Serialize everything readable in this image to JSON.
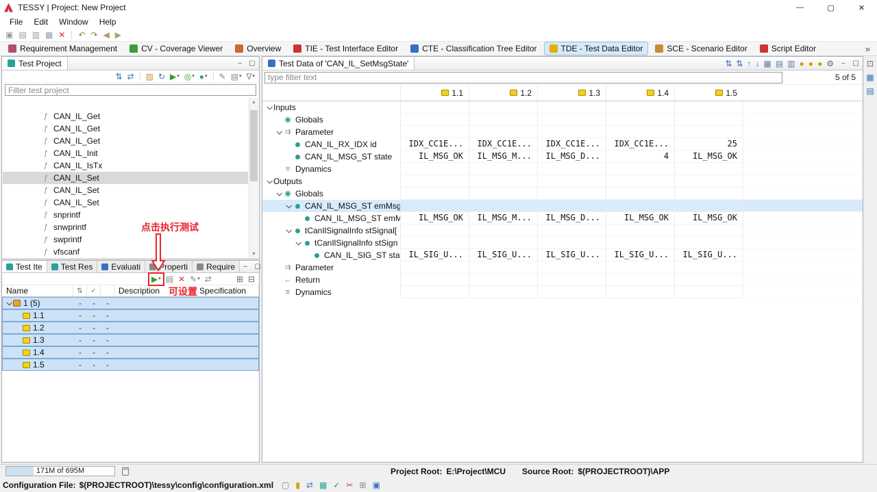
{
  "window": {
    "title": "TESSY | Project: New Project",
    "controls": [
      {
        "name": "minimize-button",
        "glyph": "—"
      },
      {
        "name": "maximize-button",
        "glyph": "▢"
      },
      {
        "name": "close-button",
        "glyph": "✕"
      }
    ]
  },
  "menu": [
    "File",
    "Edit",
    "Window",
    "Help"
  ],
  "main_toolbar": [
    {
      "name": "save-icon",
      "glyph": "▣",
      "color": "#9a9a9a"
    },
    {
      "name": "save-all-icon",
      "glyph": "▤",
      "color": "#9a9a9a"
    },
    {
      "name": "copy-icon",
      "glyph": "▥",
      "color": "#9a9a9a"
    },
    {
      "name": "paste-icon",
      "glyph": "▦",
      "color": "#9a9a9a"
    },
    {
      "name": "delete-icon",
      "glyph": "✕",
      "color": "#cc3333"
    },
    {
      "name": "separator"
    },
    {
      "name": "undo-icon",
      "glyph": "↶",
      "color": "#8a8a4a"
    },
    {
      "name": "redo-icon",
      "glyph": "↷",
      "color": "#8a8a4a"
    },
    {
      "name": "back-icon",
      "glyph": "◀",
      "color": "#b0a060"
    },
    {
      "name": "forward-icon",
      "glyph": "▶",
      "color": "#b0a060"
    }
  ],
  "perspectives": {
    "items": [
      {
        "label": "Requirement Management",
        "icon": "requirement-management-icon",
        "color": "#b05070",
        "active": false
      },
      {
        "label": "CV - Coverage Viewer",
        "icon": "coverage-viewer-icon",
        "color": "#3a9c3a",
        "active": false
      },
      {
        "label": "Overview",
        "icon": "overview-icon",
        "color": "#cc6633",
        "active": false
      },
      {
        "label": "TIE - Test Interface Editor",
        "icon": "tie-icon",
        "color": "#cc3333",
        "active": false
      },
      {
        "label": "CTE - Classification Tree Editor",
        "icon": "cte-icon",
        "color": "#3a6fc4",
        "active": false
      },
      {
        "label": "TDE - Test Data Editor",
        "icon": "tde-icon",
        "color": "#e0b000",
        "active": true
      },
      {
        "label": "SCE - Scenario Editor",
        "icon": "sce-icon",
        "color": "#cc8833",
        "active": false
      },
      {
        "label": "Script Editor",
        "icon": "script-editor-icon",
        "color": "#cc3333",
        "active": false
      }
    ],
    "overflow": "»"
  },
  "icon_map": {
    "function-icon": {
      "glyph": "ƒ",
      "color": "#8a8a8a"
    },
    "globals-icon": {
      "glyph": "◉",
      "color": "#2f9e8f"
    },
    "parameter-icon": {
      "glyph": "⇉",
      "color": "#8a8a8a"
    },
    "dynamics-icon": {
      "glyph": "≡",
      "color": "#5a8aa8"
    },
    "return-icon": {
      "glyph": "←",
      "color": "#2f9e8f"
    },
    "variable-icon": {
      "cls": "dot",
      "color": "#2f9e8f"
    },
    "struct-icon": {
      "cls": "dot",
      "color": "#2f9e8f"
    }
  },
  "test_project": {
    "tab_title": "Test Project",
    "filter_placeholder": "Filter test project",
    "toolbar": [
      {
        "name": "collapse-all-icon",
        "glyph": "⇅",
        "color": "#3a6fc4"
      },
      {
        "name": "link-with-editor-icon",
        "glyph": "⇄",
        "color": "#3a6fc4"
      },
      {
        "name": "separator"
      },
      {
        "name": "new-module-icon",
        "glyph": "▨",
        "color": "#c89b3c"
      },
      {
        "name": "refresh-icon",
        "glyph": "↻",
        "color": "#3a6fc4"
      },
      {
        "name": "run-icon",
        "glyph": "▶",
        "color": "#2e9e2e",
        "dropdown": true
      },
      {
        "name": "coverage-icon",
        "glyph": "◎",
        "color": "#2e9e2e",
        "dropdown": true
      },
      {
        "name": "report-icon",
        "glyph": "●",
        "color": "#2aa198",
        "dropdown": true
      },
      {
        "name": "separator"
      },
      {
        "name": "edit-icon",
        "glyph": "✎",
        "color": "#888888"
      },
      {
        "name": "layout-icon",
        "glyph": "▤",
        "color": "#888888",
        "dropdown": true
      },
      {
        "name": "filter-icon",
        "glyph": "∇",
        "color": "#888888",
        "dropdown": true
      }
    ],
    "items": [
      {
        "label": "CAN_IL_Get"
      },
      {
        "label": "CAN_IL_Get"
      },
      {
        "label": "CAN_IL_Get"
      },
      {
        "label": "CAN_IL_Init"
      },
      {
        "label": "CAN_IL_IsTx"
      },
      {
        "label": "CAN_IL_Set",
        "selected": true
      },
      {
        "label": "CAN_IL_Set"
      },
      {
        "label": "CAN_IL_Set"
      },
      {
        "label": "snprintf"
      },
      {
        "label": "snwprintf"
      },
      {
        "label": "swprintf"
      },
      {
        "label": "vfscanf"
      }
    ]
  },
  "test_items": {
    "tabs": [
      {
        "label": "Test Ite",
        "icon": "test-items-tab-icon",
        "color": "#2aa198",
        "active": true
      },
      {
        "label": "Test Res",
        "icon": "test-results-tab-icon",
        "color": "#2aa198",
        "active": false
      },
      {
        "label": "Evaluati",
        "icon": "evaluation-tab-icon",
        "color": "#3a6fc4",
        "active": false
      },
      {
        "label": "Properti",
        "icon": "properties-tab-icon",
        "color": "#888888",
        "active": false
      },
      {
        "label": "Require",
        "icon": "requirements-tab-icon",
        "color": "#888888",
        "active": false
      }
    ],
    "toolbar": [
      {
        "name": "run-test-button",
        "glyph": "▶",
        "color": "#2e9e2e",
        "dropdown": true,
        "boxed": true
      },
      {
        "name": "report-icon",
        "glyph": "▤",
        "color": "#888888"
      },
      {
        "name": "delete-results-icon",
        "glyph": "✕",
        "color": "#cc3333"
      },
      {
        "name": "edit-icon",
        "glyph": "✎",
        "color": "#888888",
        "dropdown": true
      },
      {
        "name": "link-icon",
        "glyph": "⇄",
        "color": "#888888"
      },
      {
        "name": "expand-all-icon",
        "glyph": "⊞",
        "color": "#666666",
        "push_right": true
      },
      {
        "name": "collapse-all-icon",
        "glyph": "⊟",
        "color": "#666666"
      }
    ],
    "header": {
      "name": "Name",
      "description": "Description",
      "specification": "Specification"
    },
    "rows": [
      {
        "label": "1 (5)",
        "level": 0,
        "expanded": true,
        "icon": "test-object-icon",
        "cells": [
          "-",
          "-",
          "-"
        ],
        "selected": true
      },
      {
        "label": "1.1",
        "level": 1,
        "icon": "test-case-icon",
        "cells": [
          "-",
          "-",
          "-"
        ],
        "selected": true
      },
      {
        "label": "1.2",
        "level": 1,
        "icon": "test-case-icon",
        "cells": [
          "-",
          "-",
          "-"
        ],
        "selected": true
      },
      {
        "label": "1.3",
        "level": 1,
        "icon": "test-case-icon",
        "cells": [
          "-",
          "-",
          "-"
        ],
        "selected": true
      },
      {
        "label": "1.4",
        "level": 1,
        "icon": "test-case-icon",
        "cells": [
          "-",
          "-",
          "-"
        ],
        "selected": true
      },
      {
        "label": "1.5",
        "level": 1,
        "icon": "test-case-icon",
        "cells": [
          "-",
          "-",
          "-"
        ],
        "selected": true
      }
    ]
  },
  "test_data": {
    "tab_title": "Test Data of 'CAN_IL_SetMsgState'",
    "filter_placeholder": "type filter text",
    "count_label": "5 of 5",
    "toolbar": [
      {
        "name": "add-testcase-icon",
        "glyph": "⇅",
        "color": "#3a6fc4"
      },
      {
        "name": "add-teststep-icon",
        "glyph": "⇅",
        "color": "#3a6fc4"
      },
      {
        "name": "move-up-icon",
        "glyph": "↑",
        "color": "#3a6fc4"
      },
      {
        "name": "move-down-icon",
        "glyph": "↓",
        "color": "#3a6fc4"
      },
      {
        "name": "table-view-icon",
        "glyph": "▦",
        "color": "#5c7ea6"
      },
      {
        "name": "matrix-view-icon",
        "glyph": "▤",
        "color": "#5c7ea6"
      },
      {
        "name": "column-config-icon",
        "glyph": "▥",
        "color": "#5c7ea6"
      },
      {
        "name": "import-data-icon",
        "glyph": "●",
        "color": "#d0a000"
      },
      {
        "name": "export-data-icon",
        "glyph": "●",
        "color": "#d0a000"
      },
      {
        "name": "clear-data-icon",
        "glyph": "●",
        "color": "#d0a000"
      },
      {
        "name": "settings-icon",
        "glyph": "⚙",
        "color": "#666666"
      }
    ],
    "columns": [
      "1.1",
      "1.2",
      "1.3",
      "1.4",
      "1.5"
    ],
    "rows": [
      {
        "label": "Inputs",
        "level": 0,
        "chevron": true
      },
      {
        "label": "Globals",
        "level": 1,
        "icon": "globals-icon"
      },
      {
        "label": "Parameter",
        "level": 1,
        "chevron": true,
        "icon": "parameter-icon"
      },
      {
        "label": "CAN_IL_RX_IDX id",
        "level": 2,
        "icon": "variable-icon",
        "values": [
          "IDX_CC1E...",
          "IDX_CC1E...",
          "IDX_CC1E...",
          "IDX_CC1E...",
          "25"
        ]
      },
      {
        "label": "CAN_IL_MSG_ST state",
        "level": 2,
        "icon": "variable-icon",
        "values": [
          "IL_MSG_OK",
          "IL_MSG_M...",
          "IL_MSG_D...",
          "4",
          "IL_MSG_OK"
        ]
      },
      {
        "label": "Dynamics",
        "level": 1,
        "icon": "dynamics-icon"
      },
      {
        "label": "Outputs",
        "level": 0,
        "chevron": true
      },
      {
        "label": "Globals",
        "level": 1,
        "chevron": true,
        "icon": "globals-icon"
      },
      {
        "label": "CAN_IL_MSG_ST emMsgS",
        "level": 2,
        "chevron": true,
        "icon": "variable-icon",
        "highlight": true
      },
      {
        "label": "CAN_IL_MSG_ST emM",
        "level": 3,
        "icon": "variable-icon",
        "values": [
          "IL_MSG_OK",
          "IL_MSG_M...",
          "IL_MSG_D...",
          "IL_MSG_OK",
          "IL_MSG_OK"
        ]
      },
      {
        "label": "tCanIlSignalInfo stSignal[",
        "level": 2,
        "chevron": true,
        "icon": "struct-icon"
      },
      {
        "label": "tCanIlSignalInfo stSign",
        "level": 3,
        "chevron": true,
        "icon": "struct-icon"
      },
      {
        "label": "CAN_IL_SIG_ST state",
        "level": 4,
        "icon": "variable-icon",
        "values": [
          "IL_SIG_U...",
          "IL_SIG_U...",
          "IL_SIG_U...",
          "IL_SIG_U...",
          "IL_SIG_U..."
        ]
      },
      {
        "label": "Parameter",
        "level": 1,
        "icon": "parameter-icon"
      },
      {
        "label": "Return",
        "level": 1,
        "icon": "return-icon"
      },
      {
        "label": "Dynamics",
        "level": 1,
        "icon": "dynamics-icon"
      }
    ]
  },
  "strip_icons": [
    {
      "name": "restore-pane-icon",
      "glyph": "⊡",
      "color": "#666666"
    },
    {
      "name": "fast-view-icon-1",
      "glyph": "▦",
      "color": "#3a6fc4"
    },
    {
      "name": "fast-view-icon-2",
      "glyph": "▤",
      "color": "#3a6fc4"
    }
  ],
  "status": {
    "memory": {
      "text": "171M of 695M",
      "fill_percent": 25
    },
    "project_root_label": "Project Root:",
    "project_root_value": "E:\\Project\\MCU",
    "source_root_label": "Source Root:",
    "source_root_value": "$(PROJECTROOT)\\APP",
    "config_label": "Configuration File:",
    "config_value": "$(PROJECTROOT)\\tessy\\config\\configuration.xml",
    "icons": [
      {
        "name": "console-icon",
        "glyph": "▢",
        "color": "#888888"
      },
      {
        "name": "bookmark-icon",
        "glyph": "▮",
        "color": "#d0a000"
      },
      {
        "name": "link-icon",
        "glyph": "⇄",
        "color": "#3a6fc4"
      },
      {
        "name": "table-icon",
        "glyph": "▦",
        "color": "#2aa198"
      },
      {
        "name": "check-icon",
        "glyph": "✓",
        "color": "#2e9e2e"
      },
      {
        "name": "cut-icon",
        "glyph": "✂",
        "color": "#cc4444"
      },
      {
        "name": "grid-icon",
        "glyph": "⊞",
        "color": "#888888"
      },
      {
        "name": "views-icon",
        "glyph": "▣",
        "color": "#3a6fc4"
      }
    ]
  },
  "annotations": {
    "run_hint": "点击执行测试",
    "settable_hint": "可设置"
  }
}
